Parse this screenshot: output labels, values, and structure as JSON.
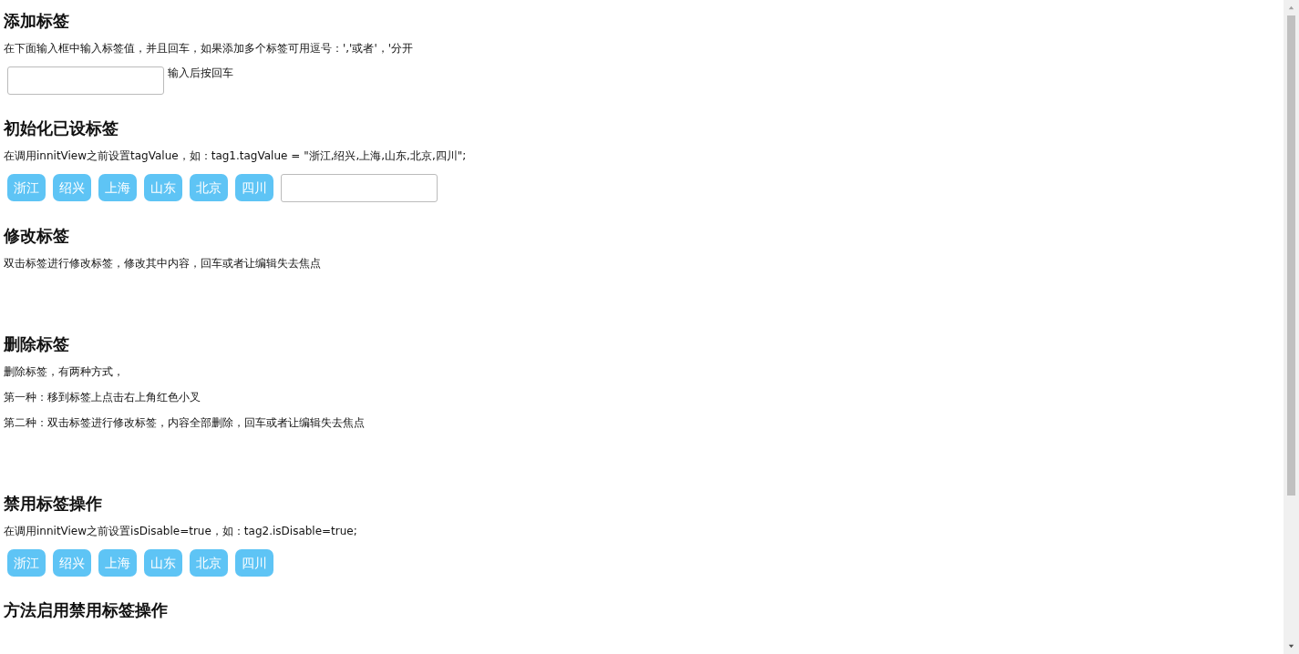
{
  "sections": [
    {
      "kind": "input",
      "heading": "添加标签",
      "paragraphs": [
        "在下面输入框中输入标签值，并且回车，如果添加多个标签可用逗号：','或者'，'分开"
      ],
      "hint": "输入后按回车"
    },
    {
      "kind": "tags_input",
      "heading": "初始化已设标签",
      "paragraphs": [
        "在调用innitView之前设置tagValue，如：tag1.tagValue = \"浙江,绍兴,上海,山东,北京,四川\";"
      ],
      "tags": [
        "浙江",
        "绍兴",
        "上海",
        "山东",
        "北京",
        "四川"
      ]
    },
    {
      "kind": "blank",
      "heading": "修改标签",
      "paragraphs": [
        "双击标签进行修改标签，修改其中内容，回车或者让编辑失去焦点"
      ]
    },
    {
      "kind": "blank",
      "heading": "删除标签",
      "paragraphs": [
        "删除标签，有两种方式，",
        "第一种：移到标签上点击右上角红色小叉",
        "第二种：双击标签进行修改标签，内容全部删除，回车或者让编辑失去焦点"
      ]
    },
    {
      "kind": "tags",
      "heading": "禁用标签操作",
      "paragraphs": [
        "在调用innitView之前设置isDisable=true，如：tag2.isDisable=true;"
      ],
      "tags": [
        "浙江",
        "绍兴",
        "上海",
        "山东",
        "北京",
        "四川"
      ]
    },
    {
      "kind": "none",
      "heading": "方法启用禁用标签操作"
    }
  ]
}
